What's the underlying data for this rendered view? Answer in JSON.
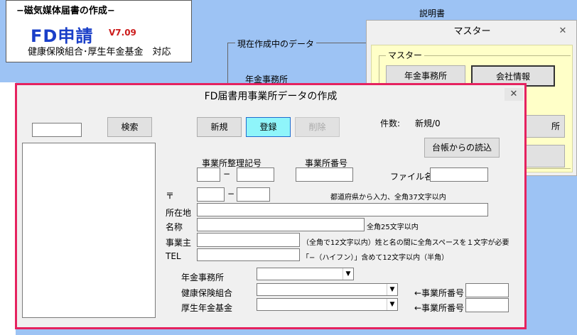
{
  "background": {
    "subtitle": "−磁気媒体届書の作成−",
    "app_name": "FD申請",
    "version": "V7.09",
    "compat": "健康保険組合･厚生年金基金　対応",
    "manual_label": "説明書",
    "current_data_label": "現在作成中のデータ",
    "pension_office_label": "年金事務所"
  },
  "master_dialog": {
    "title": "マスター",
    "close": "✕",
    "group_label": "マスター",
    "btn_pension_office": "年金事務所",
    "btn_company_info": "会社情報",
    "btn_partial": "所"
  },
  "main_dialog": {
    "title": "FD届書用事業所データの作成",
    "close": "✕",
    "search_button": "検索",
    "new_button": "新規",
    "register_button": "登録",
    "delete_button": "削除",
    "count_label": "件数:",
    "count_value": "新規/0",
    "load_from_ledger_button": "台帳からの読込",
    "office_mgmt_code_label": "事業所整理記号",
    "office_number_label": "事業所番号",
    "dash1": "−",
    "dash2": "−",
    "file_name_label": "ファイル名",
    "postal_label": "〒",
    "prefecture_note": "都道府県から入力、全角37文字以内",
    "address_label": "所在地",
    "name_label": "名称",
    "name_note": "全角25文字以内",
    "owner_label": "事業主",
    "owner_note": "（全角で12文字以内）姓と名の間に全角スペースを１文字が必要",
    "tel_label": "TEL",
    "tel_note": "「−（ハイフン）」含めて12文字以内（半角）",
    "pension_office_label": "年金事務所",
    "health_ins_label": "健康保険組合",
    "pension_fund_label": "厚生年金基金",
    "office_no_arrow1": "←事業所番号",
    "office_no_arrow2": "←事業所番号",
    "dropdown_arrow": "▼",
    "register_color": "#8ff5fa",
    "border_color": "#e5225f"
  }
}
